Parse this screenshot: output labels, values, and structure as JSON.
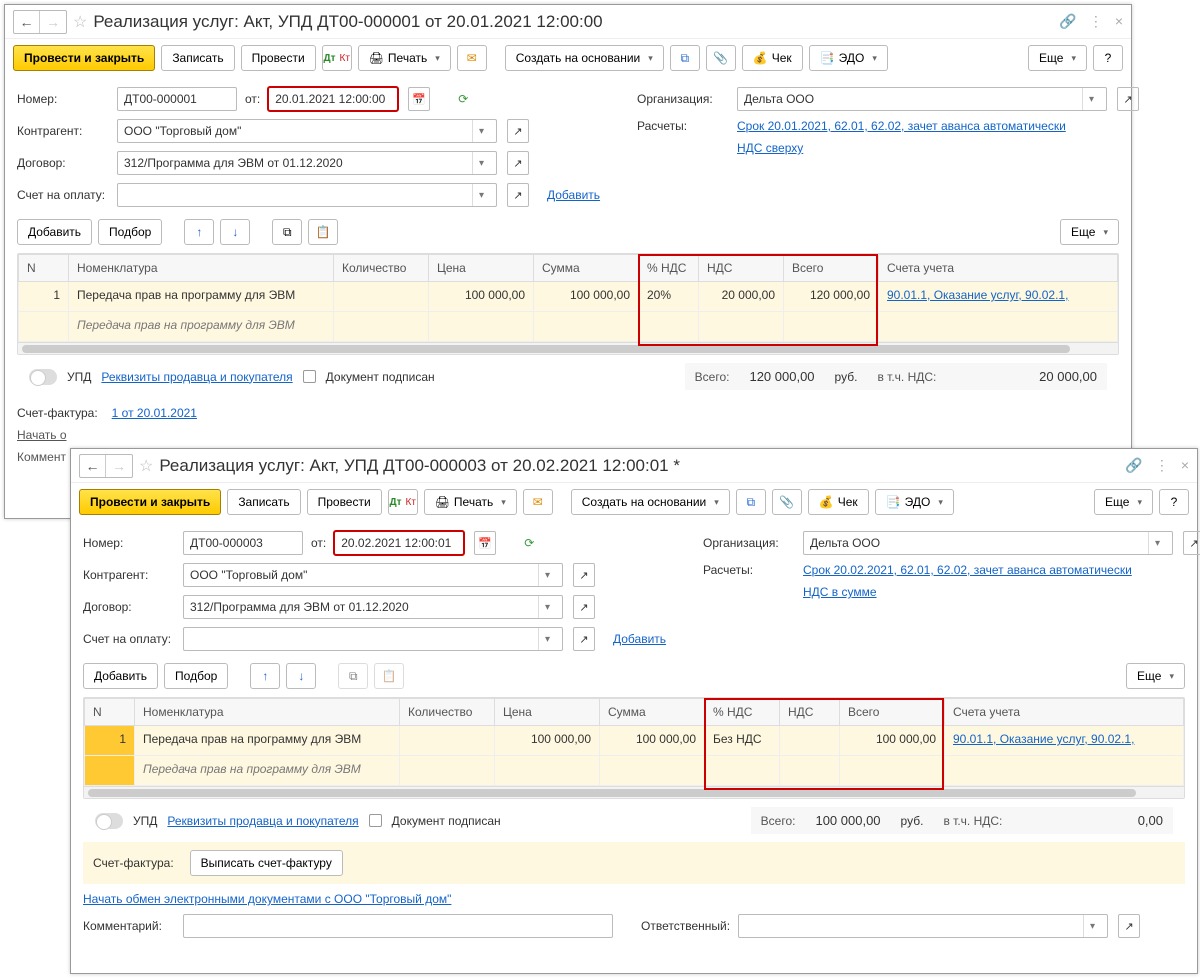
{
  "w1": {
    "title": "Реализация услуг: Акт, УПД ДТ00-000001 от 20.01.2021 12:00:00",
    "toolbar": {
      "post_close": "Провести и закрыть",
      "write": "Записать",
      "post": "Провести",
      "print": "Печать",
      "create_based": "Создать на основании",
      "cheque": "Чек",
      "edo": "ЭДО",
      "more": "Еще"
    },
    "fields": {
      "number_lbl": "Номер:",
      "number": "ДТ00-000001",
      "from_lbl": "от:",
      "date": "20.01.2021 12:00:00",
      "org_lbl": "Организация:",
      "org": "Дельта ООО",
      "contractor_lbl": "Контрагент:",
      "contractor": "ООО \"Торговый дом\"",
      "calc_lbl": "Расчеты:",
      "calc_link": "Срок 20.01.2021, 62.01, 62.02, зачет аванса автоматически",
      "contract_lbl": "Договор:",
      "contract": "312/Программа для ЭВМ от 01.12.2020",
      "nds_link": "НДС сверху",
      "invoice_lbl": "Счет на оплату:",
      "add_link": "Добавить"
    },
    "tbltb": {
      "add": "Добавить",
      "pick": "Подбор",
      "more": "Еще"
    },
    "cols": {
      "n": "N",
      "item": "Номенклатура",
      "qty": "Количество",
      "price": "Цена",
      "sum": "Сумма",
      "vatp": "% НДС",
      "vat": "НДС",
      "total": "Всего",
      "acc": "Счета учета"
    },
    "rows": [
      {
        "n": "1",
        "item": "Передача прав на программу для ЭВМ",
        "item2": "Передача прав на программу для ЭВМ",
        "qty": "",
        "price": "100 000,00",
        "sum": "100 000,00",
        "vatp": "20%",
        "vat": "20 000,00",
        "total": "120 000,00",
        "acc": "90.01.1, Оказание услуг, 90.02.1,"
      }
    ],
    "footer": {
      "upd": "УПД",
      "req_link": "Реквизиты продавца и покупателя",
      "signed": "Документ подписан",
      "tot_lbl": "Всего:",
      "tot": "120 000,00",
      "cur": "руб.",
      "vat_lbl": "в т.ч. НДС:",
      "vat": "20 000,00",
      "sf_lbl": "Счет-фактура:",
      "sf_link": "1 от 20.01.2021",
      "edo_start": "Начать о",
      "comment_lbl": "Коммент"
    }
  },
  "w2": {
    "title": "Реализация услуг: Акт, УПД ДТ00-000003 от 20.02.2021 12:00:01 *",
    "toolbar": {
      "post_close": "Провести и закрыть",
      "write": "Записать",
      "post": "Провести",
      "print": "Печать",
      "create_based": "Создать на основании",
      "cheque": "Чек",
      "edo": "ЭДО",
      "more": "Еще"
    },
    "fields": {
      "number_lbl": "Номер:",
      "number": "ДТ00-000003",
      "from_lbl": "от:",
      "date": "20.02.2021 12:00:01",
      "org_lbl": "Организация:",
      "org": "Дельта ООО",
      "contractor_lbl": "Контрагент:",
      "contractor": "ООО \"Торговый дом\"",
      "calc_lbl": "Расчеты:",
      "calc_link": "Срок 20.02.2021, 62.01, 62.02, зачет аванса автоматически",
      "contract_lbl": "Договор:",
      "contract": "312/Программа для ЭВМ от 01.12.2020",
      "nds_link": "НДС в сумме",
      "invoice_lbl": "Счет на оплату:",
      "add_link": "Добавить"
    },
    "tbltb": {
      "add": "Добавить",
      "pick": "Подбор",
      "more": "Еще"
    },
    "cols": {
      "n": "N",
      "item": "Номенклатура",
      "qty": "Количество",
      "price": "Цена",
      "sum": "Сумма",
      "vatp": "% НДС",
      "vat": "НДС",
      "total": "Всего",
      "acc": "Счета учета"
    },
    "rows": [
      {
        "n": "1",
        "item": "Передача прав на программу для ЭВМ",
        "item2": "Передача прав на программу для ЭВМ",
        "qty": "",
        "price": "100 000,00",
        "sum": "100 000,00",
        "vatp": "Без НДС",
        "vat": "",
        "total": "100 000,00",
        "acc": "90.01.1, Оказание услуг, 90.02.1,"
      }
    ],
    "footer": {
      "upd": "УПД",
      "req_link": "Реквизиты продавца и покупателя",
      "signed": "Документ подписан",
      "tot_lbl": "Всего:",
      "tot": "100 000,00",
      "cur": "руб.",
      "vat_lbl": "в т.ч. НДС:",
      "vat": "0,00",
      "sf_lbl": "Счет-фактура:",
      "sf_btn": "Выписать счет-фактуру",
      "edo_start": "Начать обмен электронными документами с ООО \"Торговый дом\"",
      "comment_lbl": "Комментарий:",
      "resp_lbl": "Ответственный:"
    }
  }
}
